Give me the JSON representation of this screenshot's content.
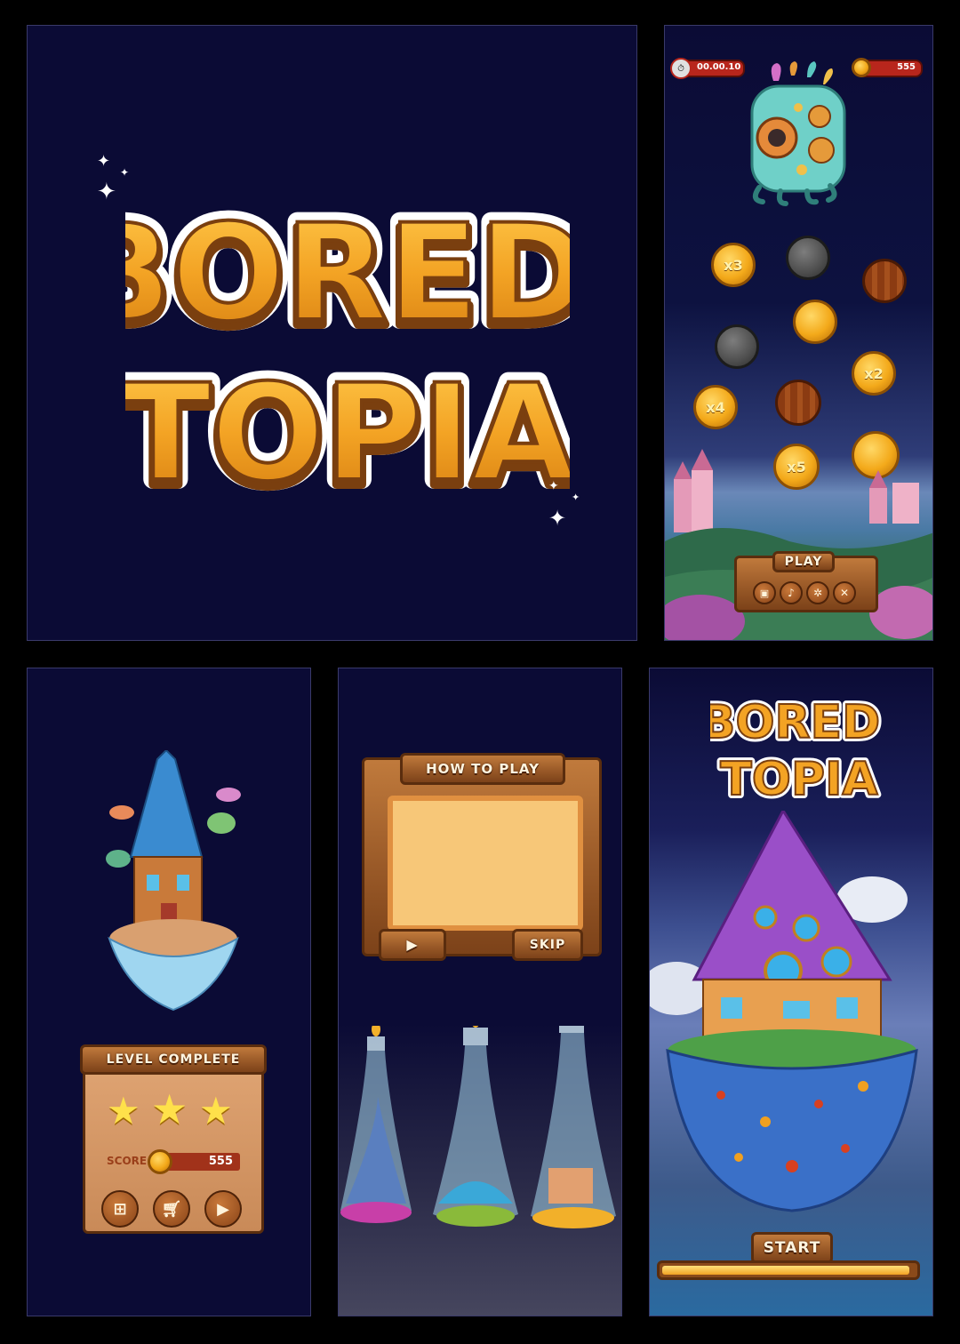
{
  "logo": {
    "line1": "BORED",
    "line2": "TOPIA"
  },
  "gameplay": {
    "timer": "00.00.10",
    "coins_count": "555",
    "multipliers": [
      "x3",
      "x2",
      "x4",
      "x5"
    ],
    "play_label": "PLAY",
    "menu_icons": [
      "lock-icon",
      "music-icon",
      "gear-icon",
      "close-icon"
    ]
  },
  "level_complete": {
    "title": "LEVEL COMPLETE",
    "stars": 3,
    "score_label": "SCORE",
    "score_value": "555",
    "buttons": [
      "levels-icon",
      "cart-icon",
      "play-icon"
    ]
  },
  "how_to_play": {
    "title": "HOW TO PLAY",
    "skip_label": "SKIP"
  },
  "start_screen": {
    "start_label": "START",
    "progress": 0.98
  },
  "colors": {
    "background": "#0b0b35",
    "logo_fill": "#f3a324",
    "logo_shadow": "#7a3f0f",
    "wood": "#a45a26",
    "gold": "#f3a91a"
  }
}
